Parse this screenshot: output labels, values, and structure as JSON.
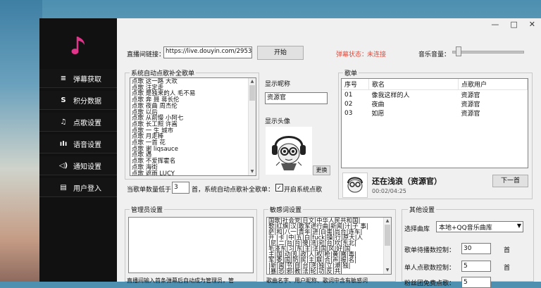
{
  "window": {
    "min_btn": "—",
    "max_btn": "□",
    "close_btn": "✕"
  },
  "sidebar": {
    "logo_icon": "music-note-icon",
    "items": [
      {
        "icon": "≡",
        "label": "弹幕获取"
      },
      {
        "icon": "S",
        "label": "积分数据"
      },
      {
        "icon": "♫",
        "label": "点歌设置"
      },
      {
        "icon": "ıIı",
        "label": "语音设置"
      },
      {
        "icon": "◁)",
        "label": "通知设置"
      },
      {
        "icon": "▤",
        "label": "用户登入"
      }
    ]
  },
  "top": {
    "live_link_label": "直播间链接：",
    "live_link_value": "https://live.douyin.com/2953",
    "start_button": "开始",
    "danmu_status_label": "弹幕状态：",
    "danmu_status_value": "未连接",
    "volume_label": "音乐音量："
  },
  "auto_list": {
    "title": "系统自动点歌补全歌单",
    "lines": [
      "点歌 这一路 大欢",
      "点歌 注定走",
      "点歌 是独来的人 毛不易",
      "点歌 奔 聂 蒋长伦",
      "点歌 夜曲 周杰伦",
      "点歌 以后",
      "点歌 从前慢 小阿七",
      "点歌 长工照 许嵩",
      "点歌 一 生 城市",
      "点歌 月走棒",
      "点歌 一首 花",
      "点歌 谢 liqsauce",
      "点歌 遇",
      "点歌 不爱挥霍名",
      "点歌 海街",
      "点歌 遮雨 LUCY"
    ]
  },
  "display": {
    "nickname_label": "显示昵称",
    "nickname_value": "资源官",
    "avatar_label": "显示头像",
    "change_button": "更换"
  },
  "playlist": {
    "title": "歌单",
    "columns": [
      "序号",
      "歌名",
      "点歌用户"
    ],
    "rows": [
      {
        "no": "01",
        "song": "像我这样的人",
        "user": "资源官"
      },
      {
        "no": "02",
        "song": "夜曲",
        "user": "资源官"
      },
      {
        "no": "03",
        "song": "如愿",
        "user": "资源官"
      }
    ],
    "now_playing_title": "还在浅浪（资源官）",
    "now_playing_time": "00:02/04:25",
    "next_button": "下一首"
  },
  "autofill": {
    "label_before": "当歌单数量低于",
    "value": "3",
    "label_after": "首，系统自动点歌补全歌单：",
    "checkbox_checked": true,
    "checkbox_label": "开启系统点歌"
  },
  "admin": {
    "title": "管理员设置",
    "hint": "直播间输入首条弹幕后自动成为管理员，管"
  },
  "banned": {
    "title": "敏感词设置",
    "lines": [
      "国歌|社会党|日文|中华人民共和国|",
      "歌|红旗|汉|敢军进行曲|新闻|汁|子 事|",
      "萨|和|八一|青年|进|白蛋|尚台|连车|",
      "开 |卡 |中|五|白|fuck|操|行|原大|人",
      "|尼|二|台|台|傻|湾|宛|台|坎|东北|",
      "毛泽东|习|东|主|法|国|风|好|国",
      "主|国|动|乱|政|人|权|枪|黄|赌|毒|",
      "军|委|国|防|民|主|联|合|声|报|名|",
      "|新|闻|节|目|台|湾|独|立|港|独|",
      "|暴|恐|邪|教|法|轮|功|反|共|"
    ],
    "footer": "歌曲名字、用户昵称、歌词中含有敏感词"
  },
  "other": {
    "title": "其他设置",
    "library_label": "选择曲库",
    "library_value": "本地+QQ音乐曲库",
    "max_wait_label": "歌单待播数控制：",
    "max_wait_value": "30",
    "per_user_label": "单人点歌数控制：",
    "per_user_value": "5",
    "third_label": "粉丝团免费点歌：",
    "third_value": "5",
    "unit": "首"
  },
  "volume_level": 0.05
}
